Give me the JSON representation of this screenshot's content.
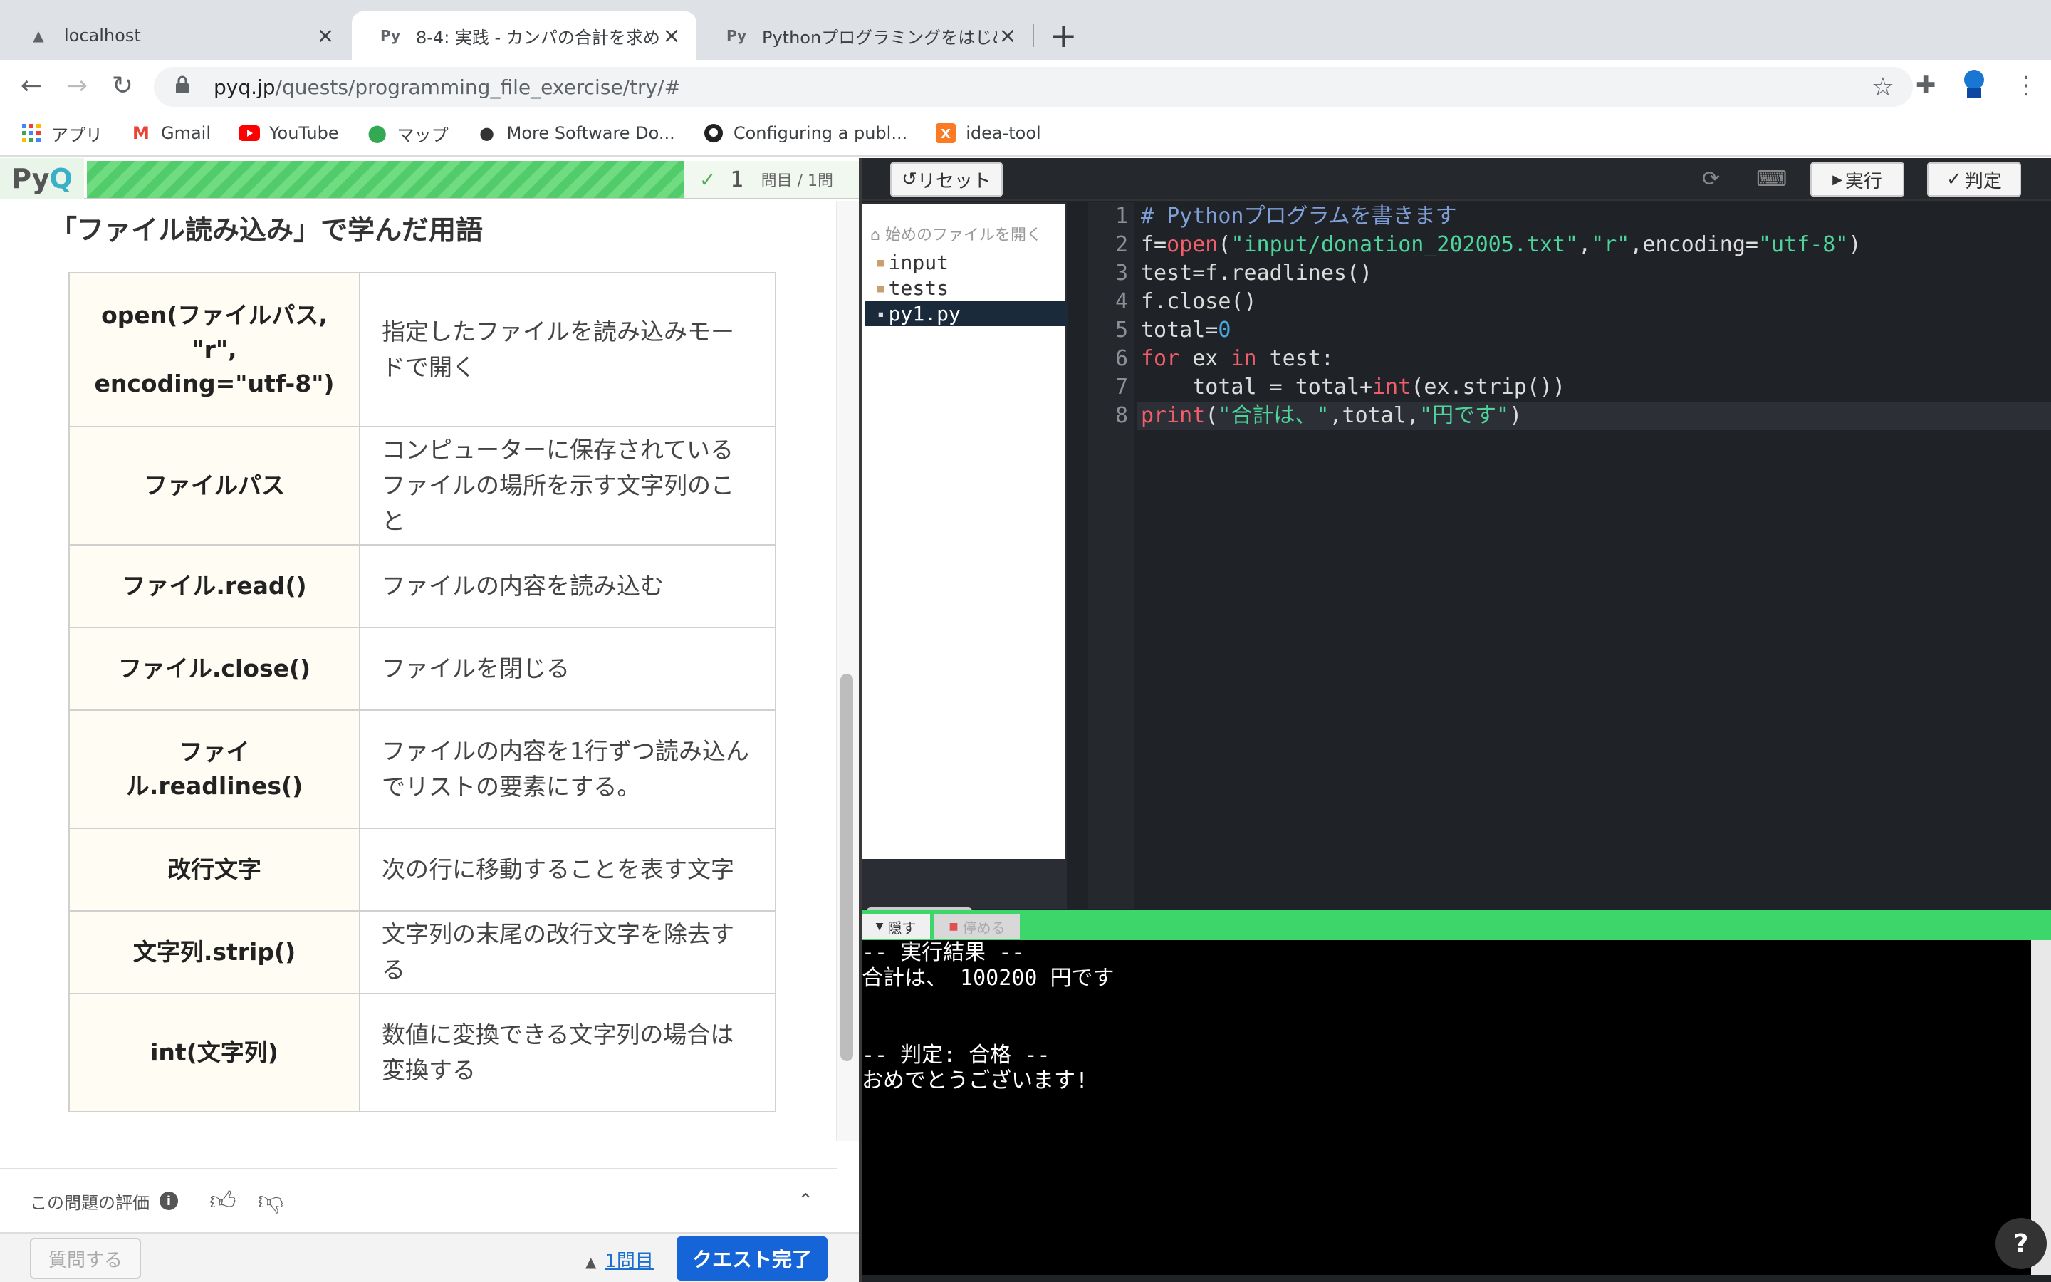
{
  "browser": {
    "tabs": [
      {
        "title": "localhost",
        "favicon": "localhost-icon"
      },
      {
        "title": "8-4: 実践 - カンパの合計を求め",
        "favicon": "pyq-icon"
      },
      {
        "title": "Pythonプログラミングをはじめよ",
        "favicon": "pyq-icon"
      }
    ],
    "url_host": "pyq.jp",
    "url_path": "/quests/programming_file_exercise/try/#",
    "bookmarks": [
      {
        "label": "アプリ",
        "icon": "apps-icon"
      },
      {
        "label": "Gmail",
        "icon": "gmail-icon"
      },
      {
        "label": "YouTube",
        "icon": "youtube-icon"
      },
      {
        "label": "マップ",
        "icon": "maps-icon"
      },
      {
        "label": "More Software Do...",
        "icon": "apple-icon"
      },
      {
        "label": "Configuring a publ...",
        "icon": "github-icon"
      },
      {
        "label": "idea-tool",
        "icon": "xampp-icon"
      }
    ]
  },
  "lesson": {
    "logo_text_a": "Py",
    "logo_text_b": "Q",
    "question_num": "1",
    "question_total": "問目 / 1問",
    "heading": "「ファイル読み込み」で学んだ用語",
    "terms": [
      {
        "term": "open(ファイルパス, \"r\", encoding=\"utf-8\")",
        "desc": "指定したファイルを読み込みモードで開く"
      },
      {
        "term": "ファイルパス",
        "desc": "コンピューターに保存されているファイルの場所を示す文字列のこと"
      },
      {
        "term": "ファイル.read()",
        "desc": "ファイルの内容を読み込む"
      },
      {
        "term": "ファイル.close()",
        "desc": "ファイルを閉じる"
      },
      {
        "term": "ファイル.readlines()",
        "desc": "ファイルの内容を1行ずつ読み込んでリストの要素にする。"
      },
      {
        "term": "改行文字",
        "desc": "次の行に移動することを表す文字"
      },
      {
        "term": "文字列.strip()",
        "desc": "文字列の末尾の改行文字を除去する"
      },
      {
        "term": "int(文字列)",
        "desc": "数値に変換できる文字列の場合は変換する"
      }
    ],
    "rating_label": "この問題の評価",
    "ask_button": "質問する",
    "question_link": "1問目",
    "complete_button": "クエスト完了"
  },
  "editor": {
    "reset_button": "リセット",
    "run_button": "実行",
    "judge_button": "判定",
    "filetree_header": "始めのファイルを開く",
    "files": [
      "input",
      "tests",
      "py1.py"
    ],
    "selected_file": "py1.py",
    "code_lines": [
      "# Pythonプログラムを書きます",
      "f=open(\"input/donation_202005.txt\",\"r\",encoding=\"utf-8\")",
      "test=f.readlines()",
      "f.close()",
      "total=0",
      "for ex in test:",
      "    total = total+int(ex.strip())",
      "print(\"合計は、\",total,\"円です\")"
    ],
    "line_numbers": [
      "1",
      "2",
      "3",
      "4",
      "5",
      "6",
      "7",
      "8"
    ],
    "output_hide": "隠す",
    "output_stop": "停める",
    "output_lines": [
      "-- 実行結果 --",
      "合計は、 100200 円です",
      "",
      "",
      "-- 判定: 合格 --",
      "おめでとうございます!"
    ],
    "help": "?"
  },
  "colors": {
    "accent_green": "#3dd66a",
    "primary_blue": "#1565d8",
    "keyword": "#f05d6b",
    "string": "#4ed39b",
    "number": "#4aa8e0",
    "comment": "#7f9fd8"
  }
}
